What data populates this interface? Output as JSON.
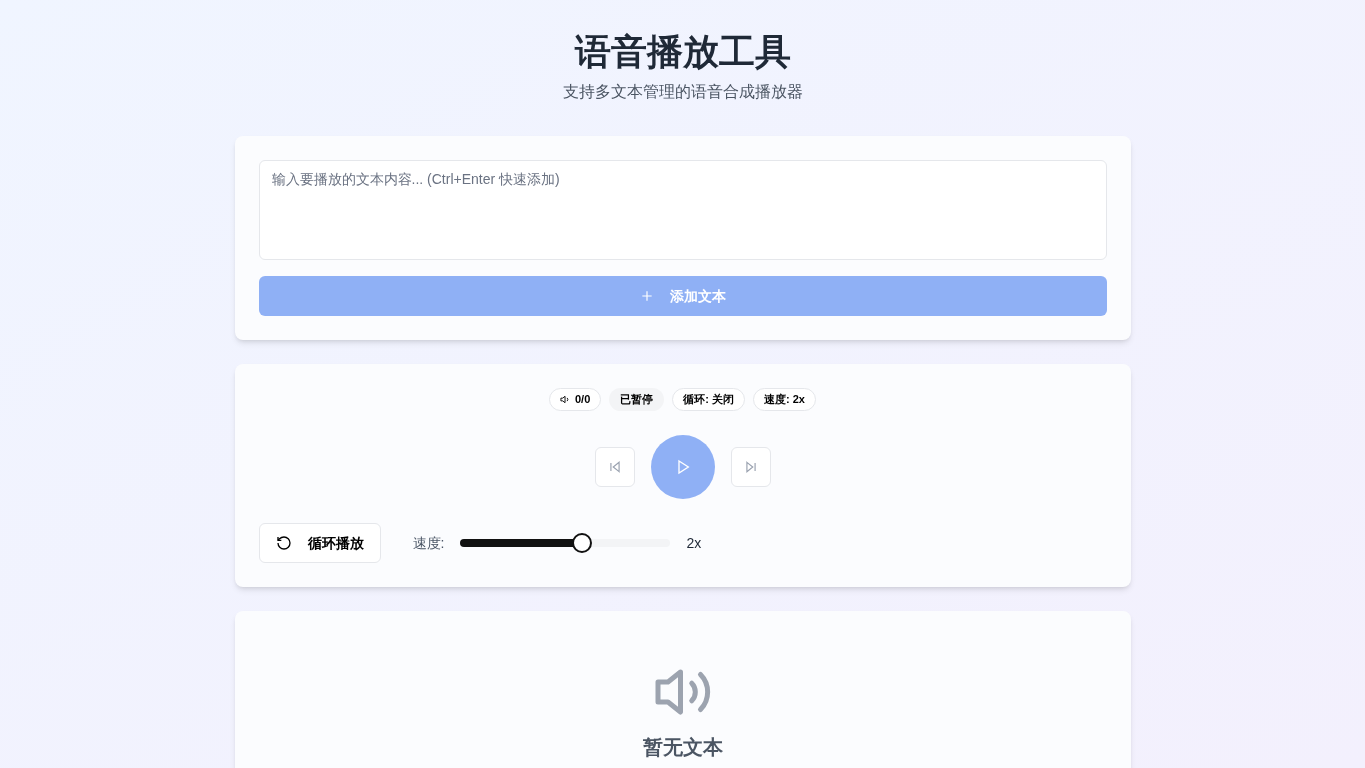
{
  "header": {
    "title": "语音播放工具",
    "subtitle": "支持多文本管理的语音合成播放器"
  },
  "input": {
    "placeholder": "输入要播放的文本内容... (Ctrl+Enter 快速添加)",
    "add_button": {
      "label": "添加文本",
      "disabled": true
    }
  },
  "player": {
    "badges": [
      {
        "kind": "count",
        "label": "0/0"
      },
      {
        "kind": "status",
        "label": "已暂停"
      },
      {
        "kind": "plain",
        "label": "循环: 关闭"
      },
      {
        "kind": "plain",
        "label": "速度: 2x"
      }
    ],
    "controls": {
      "previous_disabled": true,
      "play_disabled": true,
      "next_disabled": true
    },
    "loop_button": {
      "label": "循环播放",
      "on": false
    },
    "speed": {
      "label": "速度:",
      "level": 0.585,
      "reading": "2x"
    }
  },
  "empty_state": {
    "title": "暂无文本"
  }
}
